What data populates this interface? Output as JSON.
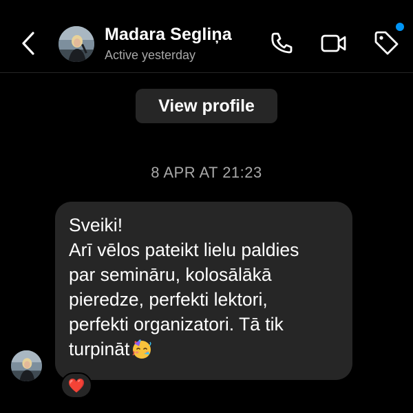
{
  "header": {
    "contact_name": "Madara Segliņa",
    "status": "Active yesterday",
    "icons": [
      "back-chevron-icon",
      "phone-icon",
      "video-camera-icon",
      "tag-icon"
    ],
    "notification_dot_color": "#0095f6"
  },
  "view_profile_label": "View profile",
  "thread": {
    "timestamp": "8 APR AT 21:23",
    "message": {
      "lines": [
        "Sveiki!",
        "Arī vēlos pateikt lielu paldies",
        "par semināru, kolosālākā",
        "pieredze, perfekti lektori,",
        "perfekti organizatori. Tā tik",
        "turpināt"
      ],
      "trailing_emoji": "partying-face-icon",
      "reaction": "❤️"
    }
  },
  "colors": {
    "background": "#000000",
    "bubble": "#262626",
    "secondary_text": "#a8a8a8"
  }
}
